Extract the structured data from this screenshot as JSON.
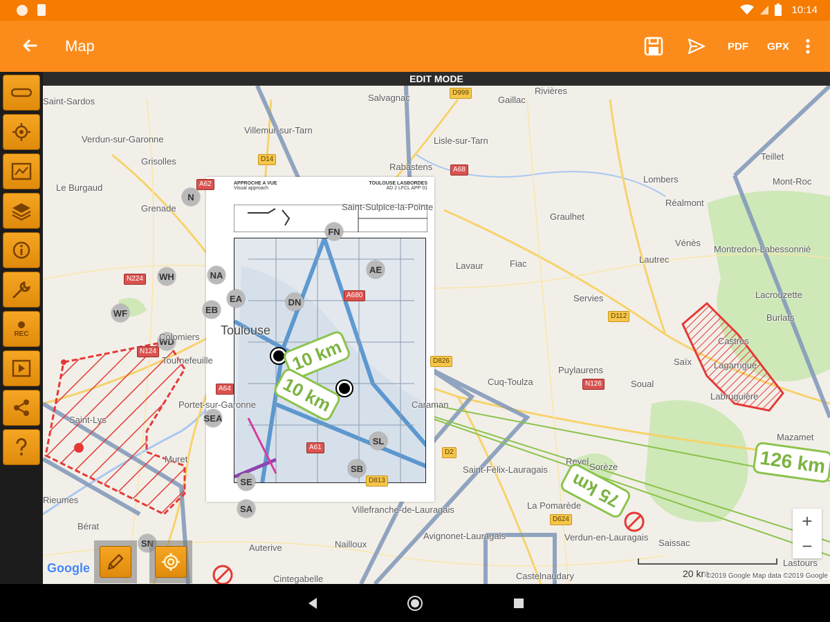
{
  "status_bar": {
    "time": "10:14",
    "icons": [
      "notification-dot-icon",
      "sd-card-icon",
      "wifi-icon",
      "signal-icon",
      "battery-icon"
    ]
  },
  "app_bar": {
    "title": "Map",
    "actions": {
      "save": "save-icon",
      "send": "send-icon",
      "pdf_label": "PDF",
      "gpx_label": "GPX",
      "more": "more-vert-icon"
    }
  },
  "toolbar": {
    "items": [
      {
        "name": "ruler",
        "icon": "ruler-icon"
      },
      {
        "name": "locate",
        "icon": "crosshair-icon"
      },
      {
        "name": "map-type",
        "icon": "map-icon"
      },
      {
        "name": "layers",
        "icon": "layers-icon"
      },
      {
        "name": "info",
        "icon": "info-icon"
      },
      {
        "name": "tools",
        "icon": "wrench-icon"
      },
      {
        "name": "record",
        "icon": "record-icon",
        "label": "REC"
      },
      {
        "name": "play",
        "icon": "play-icon"
      },
      {
        "name": "share",
        "icon": "share-icon"
      },
      {
        "name": "help",
        "icon": "help-icon"
      }
    ]
  },
  "map": {
    "mode_banner": "EDIT MODE",
    "places": [
      {
        "name": "Saint-Sardos",
        "big": false
      },
      {
        "name": "Salvagnac",
        "big": false
      },
      {
        "name": "Gaillac",
        "big": false
      },
      {
        "name": "Rivières",
        "big": false
      },
      {
        "name": "Verdun-sur-Garonne",
        "big": false
      },
      {
        "name": "Villemur-sur-Tarn",
        "big": false
      },
      {
        "name": "Lisle-sur-Tarn",
        "big": false
      },
      {
        "name": "Grisolles",
        "big": false
      },
      {
        "name": "Rabastens",
        "big": false
      },
      {
        "name": "Le Burgaud",
        "big": false
      },
      {
        "name": "Grenade",
        "big": false
      },
      {
        "name": "Saint-Sulpice-la-Pointe",
        "big": false
      },
      {
        "name": "Graulhet",
        "big": false
      },
      {
        "name": "Lombers",
        "big": false
      },
      {
        "name": "Teillet",
        "big": false
      },
      {
        "name": "Mont-Roc",
        "big": false
      },
      {
        "name": "Réalmont",
        "big": false
      },
      {
        "name": "Vénès",
        "big": false
      },
      {
        "name": "Montredon-Labessonnié",
        "big": false
      },
      {
        "name": "Lavaur",
        "big": false
      },
      {
        "name": "Fiac",
        "big": false
      },
      {
        "name": "Lautrec",
        "big": false
      },
      {
        "name": "Lacrouzette",
        "big": false
      },
      {
        "name": "Servies",
        "big": false
      },
      {
        "name": "Burlats",
        "big": false
      },
      {
        "name": "Toulouse",
        "big": true
      },
      {
        "name": "Colomiers",
        "big": false
      },
      {
        "name": "Castres",
        "big": false
      },
      {
        "name": "Tournefeuille",
        "big": false
      },
      {
        "name": "Saïx",
        "big": false
      },
      {
        "name": "Lagarrigue",
        "big": false
      },
      {
        "name": "Puylaurens",
        "big": false
      },
      {
        "name": "Cuq-Toulza",
        "big": false
      },
      {
        "name": "Soual",
        "big": false
      },
      {
        "name": "Labruguière",
        "big": false
      },
      {
        "name": "Portet-sur-Garonne",
        "big": false
      },
      {
        "name": "Caraman",
        "big": false
      },
      {
        "name": "Saint-Lys",
        "big": false
      },
      {
        "name": "Mazamet",
        "big": false
      },
      {
        "name": "Muret",
        "big": false
      },
      {
        "name": "Revel",
        "big": false
      },
      {
        "name": "Sorèze",
        "big": false
      },
      {
        "name": "Saint-Félix-Lauragais",
        "big": false
      },
      {
        "name": "Rieumes",
        "big": false
      },
      {
        "name": "La Pomarède",
        "big": false
      },
      {
        "name": "Villefranche-de-Lauragais",
        "big": false
      },
      {
        "name": "Bérat",
        "big": false
      },
      {
        "name": "Avignonet-Lauragais",
        "big": false
      },
      {
        "name": "Verdun-en-Lauragais",
        "big": false
      },
      {
        "name": "Saissac",
        "big": false
      },
      {
        "name": "Nailloux",
        "big": false
      },
      {
        "name": "Auterive",
        "big": false
      },
      {
        "name": "Castelnaudary",
        "big": false
      },
      {
        "name": "Cintegabelle",
        "big": false
      },
      {
        "name": "Lastours",
        "big": false
      }
    ],
    "roads": [
      {
        "label": "D999",
        "red": false
      },
      {
        "label": "D14",
        "red": false
      },
      {
        "label": "A68",
        "red": true
      },
      {
        "label": "A62",
        "red": true
      },
      {
        "label": "N224",
        "red": true
      },
      {
        "label": "N124",
        "red": true
      },
      {
        "label": "A64",
        "red": true
      },
      {
        "label": "A680",
        "red": true
      },
      {
        "label": "D112",
        "red": false
      },
      {
        "label": "D826",
        "red": false
      },
      {
        "label": "N126",
        "red": true
      },
      {
        "label": "A61",
        "red": true
      },
      {
        "label": "D2",
        "red": false
      },
      {
        "label": "D813",
        "red": false
      },
      {
        "label": "D624",
        "red": false
      }
    ],
    "waypoints": [
      "N",
      "WH",
      "NA",
      "EB",
      "WF",
      "EA",
      "DN",
      "WD",
      "FN",
      "AE",
      "SEA",
      "SL",
      "SB",
      "SE",
      "SA",
      "SN"
    ],
    "approach_chart": {
      "title": "APPROCHE A VUE",
      "subtitle": "Visual approach",
      "airport": "TOULOUSE LASBORDES",
      "code": "AD 2 LFCL APP 01"
    },
    "distance_labels": [
      "10 km",
      "10 km",
      "75 km",
      "126 km"
    ],
    "zoom": {
      "in": "+",
      "out": "−"
    },
    "attribution": "Google",
    "scale": "20 km",
    "copyright": "©2019 Google  Map data ©2019 Google"
  },
  "bottom_buttons": [
    {
      "name": "edit",
      "icon": "pencil-icon"
    },
    {
      "name": "gps",
      "icon": "target-icon"
    }
  ],
  "nav_bar": {
    "back": "back-triangle-icon",
    "home": "home-circle-icon",
    "recents": "recents-square-icon"
  }
}
